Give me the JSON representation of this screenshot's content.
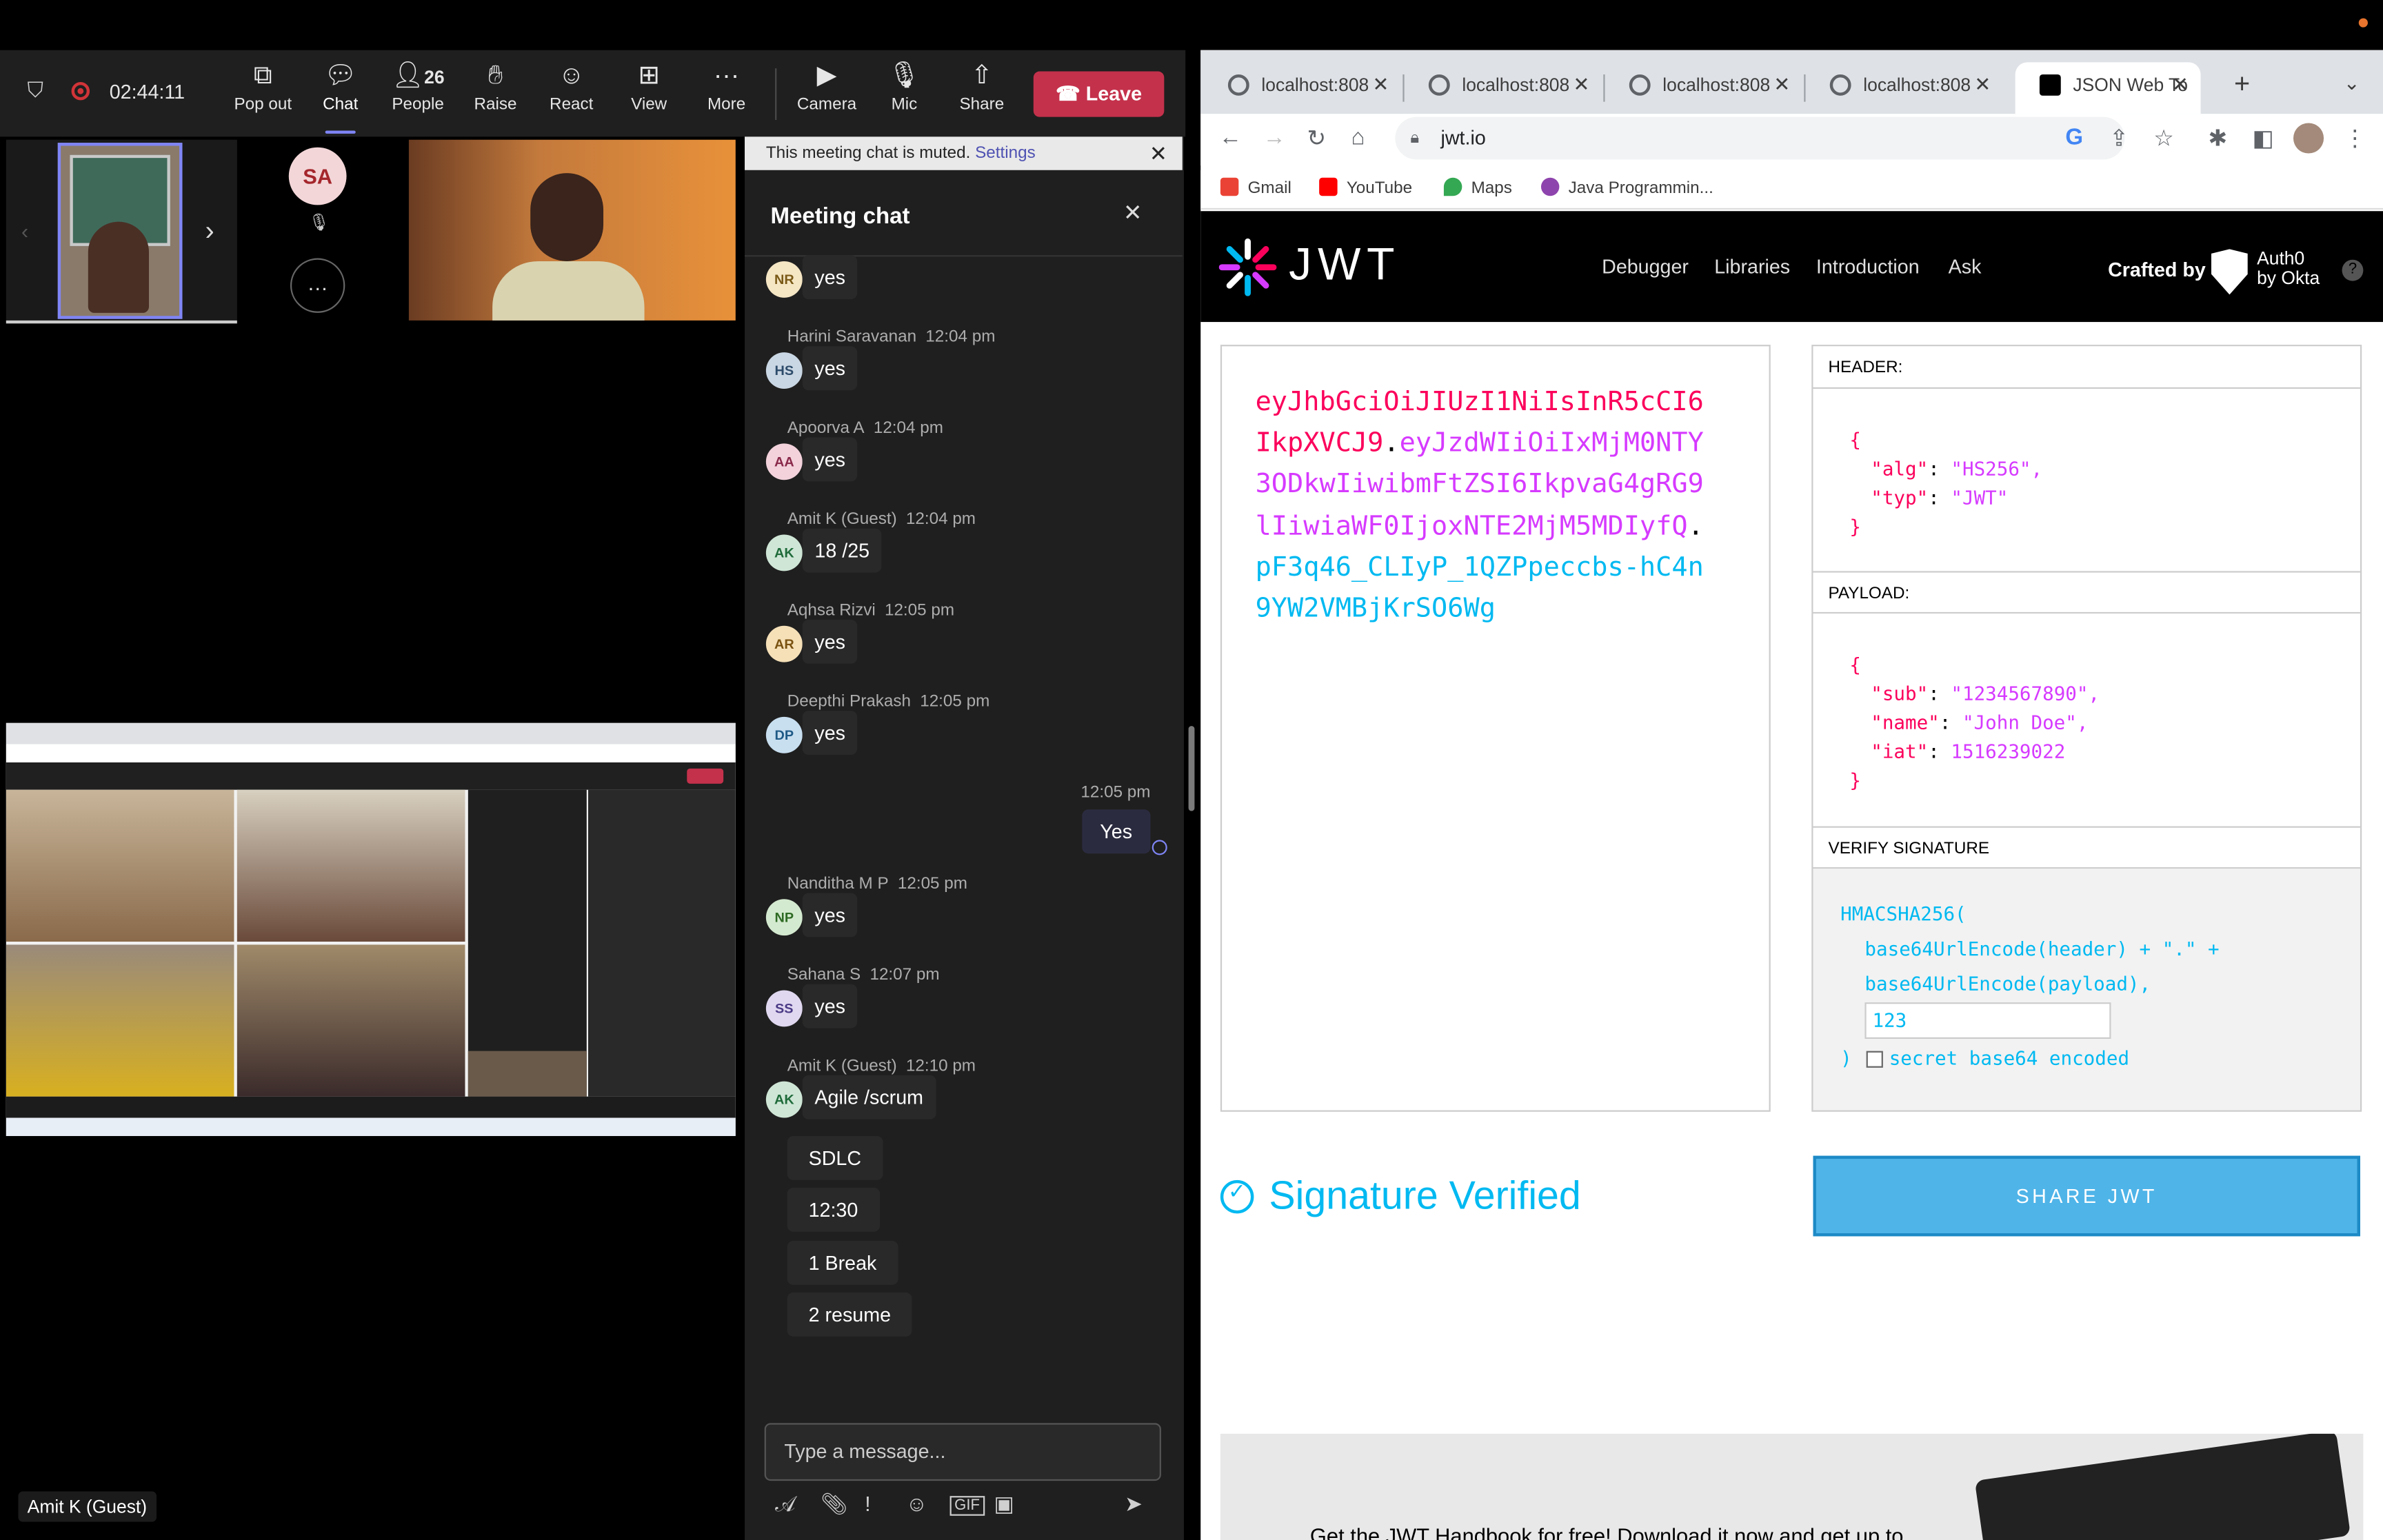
{
  "teams": {
    "timer": "02:44:11",
    "toolbar": {
      "popout": "Pop out",
      "chat": "Chat",
      "people": "People",
      "people_count": "26",
      "raise": "Raise",
      "react": "React",
      "view": "View",
      "more": "More",
      "camera": "Camera",
      "mic": "Mic",
      "share": "Share",
      "leave": "Leave"
    },
    "participant_initials": "SA",
    "guest_label": "Amit K (Guest)"
  },
  "chat": {
    "muted_text": "This meeting chat is muted.",
    "muted_link": "Settings",
    "title": "Meeting chat",
    "messages": [
      {
        "sender": "",
        "time": "",
        "initials": "NR",
        "text": "yes",
        "avatar_bg": "#f5e6c4",
        "avatar_fg": "#7a5a17"
      },
      {
        "sender": "Harini Saravanan",
        "time": "12:04 pm",
        "initials": "HS",
        "text": "yes",
        "avatar_bg": "#c9d6e3",
        "avatar_fg": "#2d4c6b"
      },
      {
        "sender": "Apoorva A",
        "time": "12:04 pm",
        "initials": "AA",
        "text": "yes",
        "avatar_bg": "#f3d2dc",
        "avatar_fg": "#8a2a4a"
      },
      {
        "sender": "Amit K (Guest)",
        "time": "12:04 pm",
        "initials": "AK",
        "text": "18 /25",
        "avatar_bg": "#cfe6d6",
        "avatar_fg": "#1f6b3a"
      },
      {
        "sender": "Aqhsa Rizvi",
        "time": "12:05 pm",
        "initials": "AR",
        "text": "yes",
        "avatar_bg": "#f5e0b8",
        "avatar_fg": "#7a5211"
      },
      {
        "sender": "Deepthi Prakash",
        "time": "12:05 pm",
        "initials": "DP",
        "text": "yes",
        "avatar_bg": "#c8dff0",
        "avatar_fg": "#1f5a86"
      },
      {
        "sender": "Nanditha M P",
        "time": "12:05 pm",
        "initials": "NP",
        "text": "yes",
        "avatar_bg": "#d4ead0",
        "avatar_fg": "#2e6b24"
      },
      {
        "sender": "Sahana S",
        "time": "12:07 pm",
        "initials": "SS",
        "text": "yes",
        "avatar_bg": "#e0d8f0",
        "avatar_fg": "#4b3a86"
      },
      {
        "sender": "Amit K (Guest)",
        "time": "12:10 pm",
        "initials": "AK",
        "text": "Agile /scrum",
        "avatar_bg": "#cfe6d6",
        "avatar_fg": "#1f6b3a"
      }
    ],
    "my_message": {
      "time": "12:05 pm",
      "text": "Yes"
    },
    "followups": [
      "SDLC",
      "12:30",
      "1 Break",
      "2 resume"
    ],
    "compose_placeholder": "Type a message..."
  },
  "browser": {
    "tabs": [
      "localhost:808",
      "localhost:808",
      "localhost:808",
      "localhost:808",
      "JSON Web To"
    ],
    "url": "jwt.io",
    "bookmarks": [
      "Gmail",
      "YouTube",
      "Maps",
      "Java Programmin..."
    ]
  },
  "jwt": {
    "logo": "JWT",
    "nav": [
      "Debugger",
      "Libraries",
      "Introduction",
      "Ask"
    ],
    "crafted_by": "Crafted by",
    "auth0_line1": "Auth0",
    "auth0_line2": "by Okta",
    "encoded_header": "eyJhbGciOiJIUzI1NiIsInR5cCI6IkpXVCJ9",
    "encoded_payload": "eyJzdWIiOiIxMjM0NTY3ODkwIiwibmFtZSI6IkpvaG4gRG9lIiwiaWF0IjoxNTE2MjM5MDIyfQ",
    "encoded_signature": "pF3q46_CLIyP_1QZPpeccbs-hC4n9YW2VMBjKrSO6Wg",
    "header_label": "HEADER:",
    "payload_label": "PAYLOAD:",
    "verify_label": "VERIFY SIGNATURE",
    "header_alg_key": "\"alg\"",
    "header_alg_val": "\"HS256\",",
    "header_typ_key": "\"typ\"",
    "header_typ_val": "\"JWT\"",
    "payload_sub_key": "\"sub\"",
    "payload_sub_val": "\"1234567890\",",
    "payload_name_key": "\"name\"",
    "payload_name_val": "\"John Doe\",",
    "payload_iat_key": "\"iat\"",
    "payload_iat_val": "1516239022",
    "verify_fn": "HMACSHA256(",
    "verify_line1": "base64UrlEncode(header) + \".\" +",
    "verify_line2": "base64UrlEncode(payload),",
    "secret_value": "123",
    "verify_close": ")",
    "secret_b64_label": "secret base64 encoded",
    "signature_status": "Signature Verified",
    "share_button": "SHARE JWT",
    "promo_text": "Get the JWT Handbook for free! Download it now and get up to"
  }
}
